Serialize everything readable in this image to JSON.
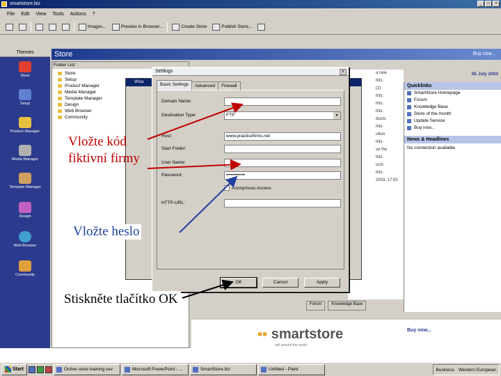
{
  "window": {
    "title": "smartstore.biz"
  },
  "menu": [
    "File",
    "Edit",
    "View",
    "Tools",
    "Actions",
    "?"
  ],
  "toolbar": {
    "items": [
      "Images...",
      "Preview in Browser...",
      "Create Store",
      "Publish Store..."
    ]
  },
  "sidebar": {
    "header": "Themes",
    "items": [
      "Store",
      "Setup",
      "Product Manager",
      "Media Manager",
      "Template Manager",
      "Design",
      "Web Browser",
      "Community"
    ]
  },
  "store_header": {
    "title": "Store",
    "buy_now": "Buy now..."
  },
  "folder_panel": {
    "header": "Folder List",
    "tree": [
      "Store",
      "Setup",
      "Product Manager",
      "Media Manager",
      "Template Manager",
      "Design",
      "Web Browser",
      "Community"
    ]
  },
  "wizard": {
    "title": "Wiza"
  },
  "date_text": "06 July 2003",
  "quicklinks": {
    "header": "Quicklinks",
    "items": [
      "SmartStore Homepage",
      "Forum",
      "Knowledge Base",
      "Store of the month",
      "Update Service",
      "Buy now..."
    ],
    "news_header": "News & Headlines",
    "news_text": "No connection available"
  },
  "middle_col": [
    "a new",
    "hits:",
    "(2)",
    "hits:",
    "hits:",
    "hits:",
    "ducts",
    "hits:",
    "utton",
    "hits:",
    "ve the",
    "hits:",
    "ucts",
    "hits:",
    "2003, 17:50"
  ],
  "dialog": {
    "title": "Settings",
    "close": "x",
    "tabs": [
      "Basic Settings",
      "Advanced",
      "Firewall"
    ],
    "fields": {
      "domain_label": "Domain Name:",
      "domain_value": "",
      "dest_label": "Destination Type:",
      "dest_value": "FTP",
      "host_label": "Host:",
      "host_value": "www.practicefirms.net",
      "start_label": "Start Folder:",
      "start_value": "",
      "user_label": "User Name:",
      "user_value": "",
      "pass_label": "Password:",
      "pass_value": "••••••••••••",
      "anon_label": "Anonymous Access",
      "http_label": "HTTP-URL:",
      "http_value": ""
    },
    "buttons": {
      "ok": "OK",
      "cancel": "Cancel",
      "apply": "Apply"
    }
  },
  "annotations": {
    "code": "Vložte kód fiktivní firmy",
    "password": "Vložte heslo",
    "ok": "Stiskněte tlačítko OK"
  },
  "banner": {
    "logo": "smartstore",
    "tagline": "sell around the world",
    "buy": "Buy now..."
  },
  "bottom_tabs": [
    "Forum",
    "Knowledge Base"
  ],
  "taskbar": {
    "start": "Start",
    "tasks": [
      "Online store training cev",
      "Microsoft PowerPoint - ...",
      "SmartStore.biz",
      "Untitled - Paint"
    ],
    "tray": [
      "Business",
      "Western European"
    ]
  }
}
